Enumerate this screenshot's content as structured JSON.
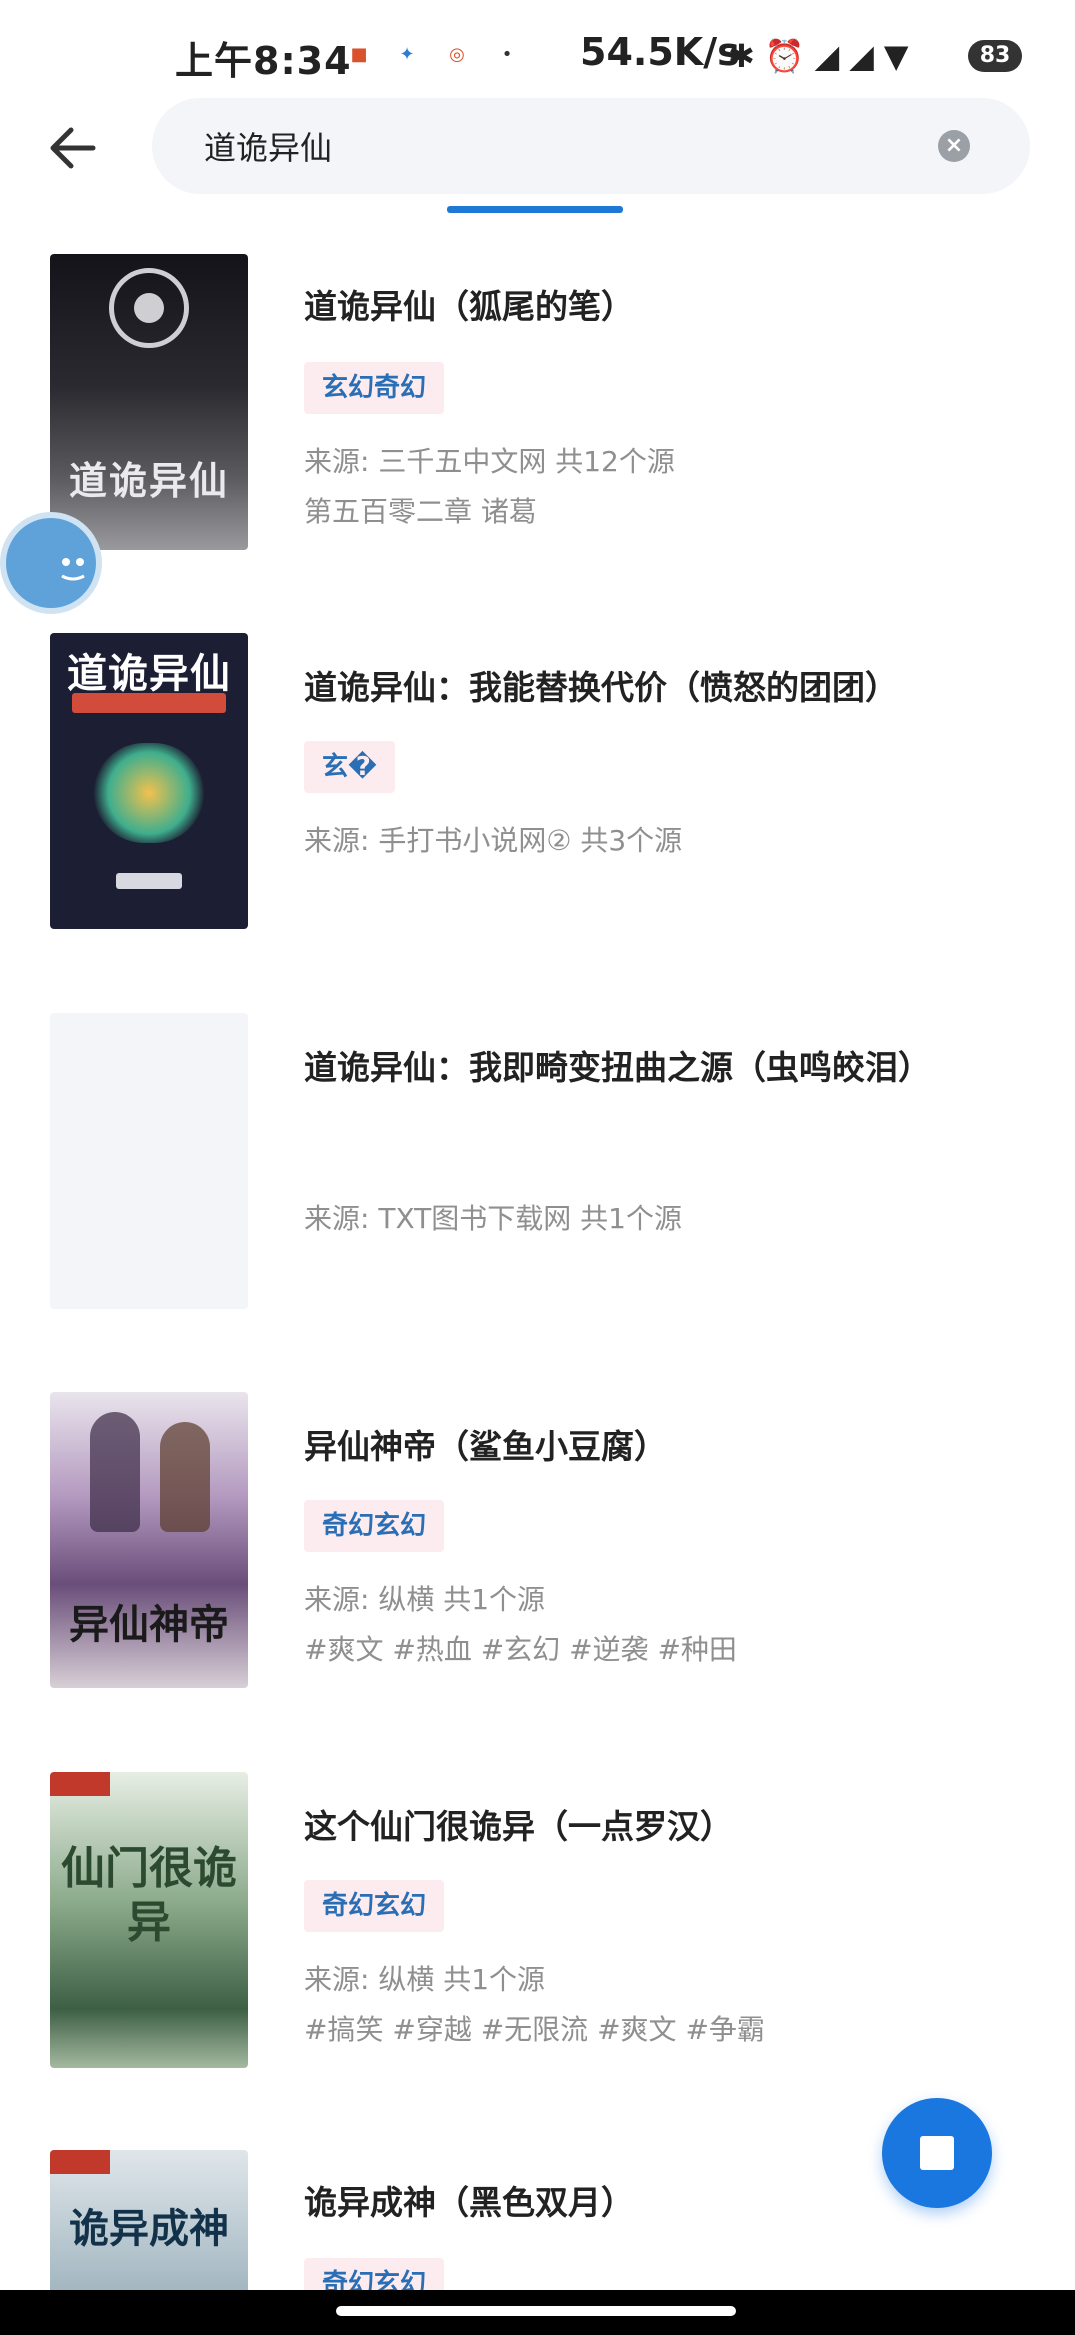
{
  "status_bar": {
    "time": "上午8:34",
    "network_speed": "54.5K/s",
    "battery": "83",
    "icons": [
      "bluetooth-icon",
      "alarm-icon",
      "signal-icon",
      "signal-icon",
      "wifi-icon"
    ]
  },
  "search": {
    "value": "道诡异仙",
    "placeholder": ""
  },
  "colors": {
    "accent": "#1e79d6",
    "tag_bg": "#fdecef",
    "tag_text": "#2a6fb6",
    "meta_text": "#8f8f8f"
  },
  "results": [
    {
      "title": "道诡异仙（狐尾的笔）",
      "tag": "玄幻奇幻",
      "source": "来源: 三千五中文网  共12个源",
      "extra": "第五百零二章 诸葛",
      "cover_text": "道诡异仙"
    },
    {
      "title": "道诡异仙：我能替换代价（愤怒的团团）",
      "tag": "玄�",
      "source": "来源: 手打书小说网②  共3个源",
      "extra": "",
      "cover_text": "道诡异仙"
    },
    {
      "title": "道诡异仙：我即畸变扭曲之源（虫鸣皎泪）",
      "tag": "",
      "source": "来源: TXT图书下载网  共1个源",
      "extra": "",
      "cover_text": ""
    },
    {
      "title": "异仙神帝（鲨鱼小豆腐）",
      "tag": "奇幻玄幻",
      "source": "来源: 纵横  共1个源",
      "extra": "#爽文  #热血  #玄幻  #逆袭  #种田",
      "cover_text": "异仙神帝"
    },
    {
      "title": "这个仙门很诡异（一点罗汉）",
      "tag": "奇幻玄幻",
      "source": "来源: 纵横  共1个源",
      "extra": "#搞笑  #穿越  #无限流  #爽文  #争霸",
      "cover_text": "仙门很诡异"
    },
    {
      "title": "诡异成神（黑色双月）",
      "tag": "奇幻玄幻",
      "source": "",
      "extra": "",
      "cover_text": "诡异成神"
    }
  ]
}
